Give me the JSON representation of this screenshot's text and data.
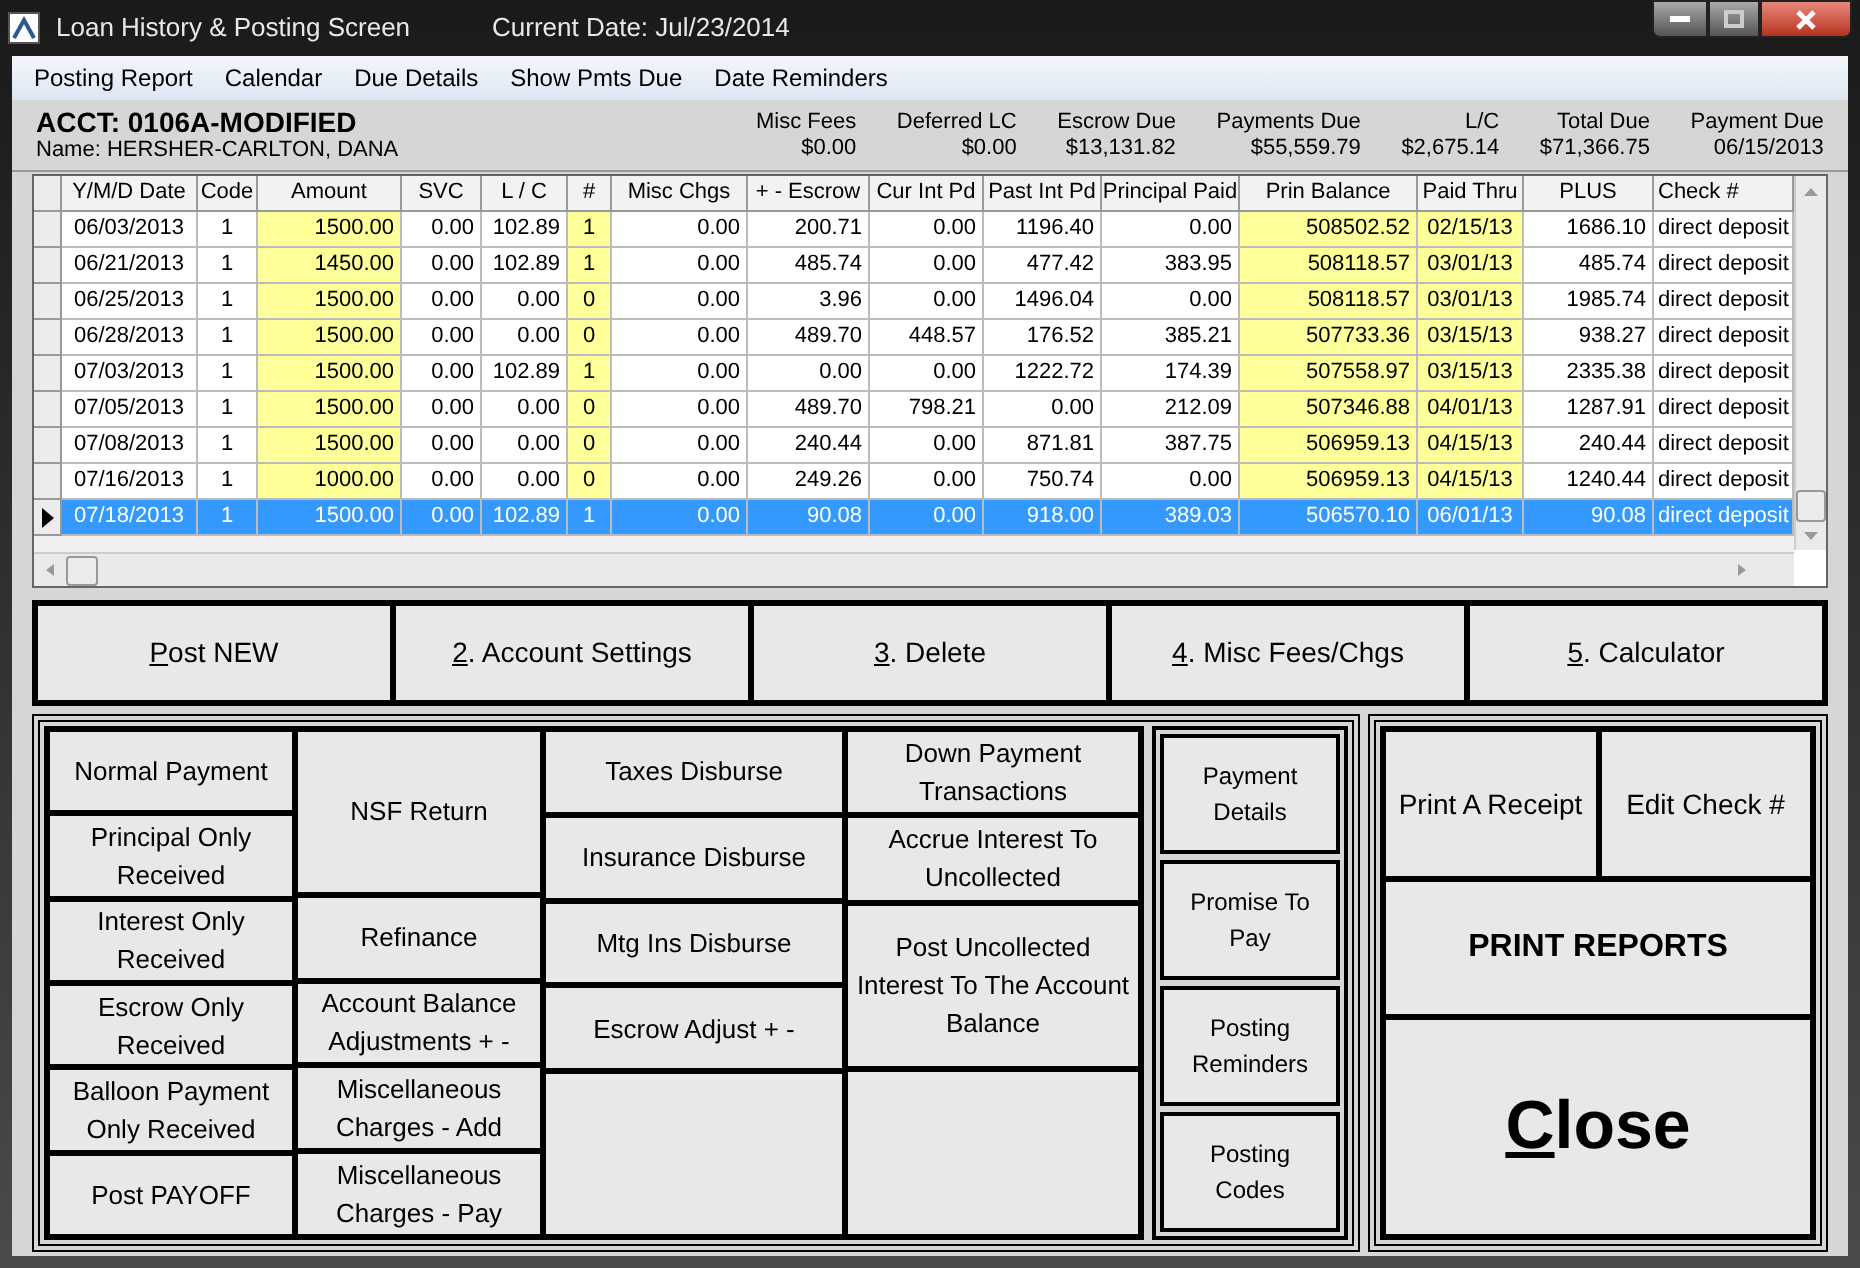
{
  "window": {
    "title": "Loan History & Posting Screen",
    "current_date": "Current Date:  Jul/23/2014"
  },
  "menu": [
    "Posting Report",
    "Calendar",
    "Due Details",
    "Show Pmts Due",
    "Date Reminders"
  ],
  "account": {
    "acct": "ACCT: 0106A-MODIFIED",
    "name": "Name: HERSHER-CARLTON, DANA"
  },
  "summary": [
    {
      "label": "Misc Fees",
      "value": "$0.00"
    },
    {
      "label": "Deferred LC",
      "value": "$0.00"
    },
    {
      "label": "Escrow Due",
      "value": "$13,131.82"
    },
    {
      "label": "Payments Due",
      "value": "$55,559.79"
    },
    {
      "label": "L/C",
      "value": "$2,675.14"
    },
    {
      "label": "Total Due",
      "value": "$71,366.75"
    },
    {
      "label": "Payment Due",
      "value": "06/15/2013"
    }
  ],
  "table": {
    "columns": [
      {
        "label": "Y/M/D Date",
        "highlight": false
      },
      {
        "label": "Code",
        "highlight": false
      },
      {
        "label": "Amount",
        "highlight": true
      },
      {
        "label": "SVC",
        "highlight": false
      },
      {
        "label": "L / C",
        "highlight": false
      },
      {
        "label": "#",
        "highlight": true
      },
      {
        "label": "Misc Chgs",
        "highlight": false
      },
      {
        "label": "+ - Escrow",
        "highlight": false
      },
      {
        "label": "Cur Int Pd",
        "highlight": false
      },
      {
        "label": "Past Int Pd",
        "highlight": false
      },
      {
        "label": "Principal Paid",
        "highlight": false
      },
      {
        "label": "Prin Balance",
        "highlight": true
      },
      {
        "label": "Paid Thru",
        "highlight": true
      },
      {
        "label": "PLUS",
        "highlight": false
      },
      {
        "label": "Check #",
        "highlight": false
      }
    ],
    "rows": [
      {
        "selected": false,
        "cells": [
          "06/03/2013",
          "1",
          "1500.00",
          "0.00",
          "102.89",
          "1",
          "0.00",
          "200.71",
          "0.00",
          "1196.40",
          "0.00",
          "508502.52",
          "02/15/13",
          "1686.10",
          "direct deposit"
        ]
      },
      {
        "selected": false,
        "cells": [
          "06/21/2013",
          "1",
          "1450.00",
          "0.00",
          "102.89",
          "1",
          "0.00",
          "485.74",
          "0.00",
          "477.42",
          "383.95",
          "508118.57",
          "03/01/13",
          "485.74",
          "direct deposit"
        ]
      },
      {
        "selected": false,
        "cells": [
          "06/25/2013",
          "1",
          "1500.00",
          "0.00",
          "0.00",
          "0",
          "0.00",
          "3.96",
          "0.00",
          "1496.04",
          "0.00",
          "508118.57",
          "03/01/13",
          "1985.74",
          "direct deposit"
        ]
      },
      {
        "selected": false,
        "cells": [
          "06/28/2013",
          "1",
          "1500.00",
          "0.00",
          "0.00",
          "0",
          "0.00",
          "489.70",
          "448.57",
          "176.52",
          "385.21",
          "507733.36",
          "03/15/13",
          "938.27",
          "direct deposit"
        ]
      },
      {
        "selected": false,
        "cells": [
          "07/03/2013",
          "1",
          "1500.00",
          "0.00",
          "102.89",
          "1",
          "0.00",
          "0.00",
          "0.00",
          "1222.72",
          "174.39",
          "507558.97",
          "03/15/13",
          "2335.38",
          "direct deposit"
        ]
      },
      {
        "selected": false,
        "cells": [
          "07/05/2013",
          "1",
          "1500.00",
          "0.00",
          "0.00",
          "0",
          "0.00",
          "489.70",
          "798.21",
          "0.00",
          "212.09",
          "507346.88",
          "04/01/13",
          "1287.91",
          "direct deposit"
        ]
      },
      {
        "selected": false,
        "cells": [
          "07/08/2013",
          "1",
          "1500.00",
          "0.00",
          "0.00",
          "0",
          "0.00",
          "240.44",
          "0.00",
          "871.81",
          "387.75",
          "506959.13",
          "04/15/13",
          "240.44",
          "direct deposit"
        ]
      },
      {
        "selected": false,
        "cells": [
          "07/16/2013",
          "1",
          "1000.00",
          "0.00",
          "0.00",
          "0",
          "0.00",
          "249.26",
          "0.00",
          "750.74",
          "0.00",
          "506959.13",
          "04/15/13",
          "1240.44",
          "direct deposit"
        ]
      },
      {
        "selected": true,
        "cells": [
          "07/18/2013",
          "1",
          "1500.00",
          "0.00",
          "102.89",
          "1",
          "0.00",
          "90.08",
          "0.00",
          "918.00",
          "389.03",
          "506570.10",
          "06/01/13",
          "90.08",
          "direct deposit"
        ]
      }
    ]
  },
  "actions": [
    {
      "accel": "P",
      "rest": "ost NEW"
    },
    {
      "accel": "2",
      "rest": ". Account Settings"
    },
    {
      "accel": "3",
      "rest": ". Delete"
    },
    {
      "accel": "4",
      "rest": ". Misc Fees/Chgs"
    },
    {
      "accel": "5",
      "rest": ". Calculator"
    }
  ],
  "posting_columns": [
    [
      {
        "kind": "single",
        "label": "Normal Payment"
      },
      {
        "kind": "single",
        "label": "Principal Only Received"
      },
      {
        "kind": "single",
        "label": "Interest Only Received"
      },
      {
        "kind": "single",
        "label": "Escrow Only Received"
      },
      {
        "kind": "single",
        "label": "Balloon Payment Only Received"
      },
      {
        "kind": "single",
        "label": "Post PAYOFF"
      }
    ],
    [
      {
        "kind": "double",
        "label": "NSF Return"
      },
      {
        "kind": "single",
        "label": "Refinance"
      },
      {
        "kind": "single",
        "label": "Account Balance Adjustments  + -"
      },
      {
        "kind": "single",
        "label": "Miscellaneous Charges - Add"
      },
      {
        "kind": "single",
        "label": "Miscellaneous Charges - Pay"
      }
    ],
    [
      {
        "kind": "single",
        "label": "Taxes Disburse"
      },
      {
        "kind": "single",
        "label": "Insurance Disburse"
      },
      {
        "kind": "single",
        "label": "Mtg Ins Disburse"
      },
      {
        "kind": "single",
        "label": "Escrow Adjust + -"
      },
      {
        "kind": "blank"
      }
    ],
    [
      {
        "kind": "single",
        "label": "Down Payment Transactions"
      },
      {
        "kind": "single",
        "label": "Accrue Interest  To Uncollected"
      },
      {
        "kind": "double",
        "label": "Post Uncollected Interest To The Account Balance"
      },
      {
        "kind": "blank"
      }
    ]
  ],
  "side_buttons": [
    "Payment Details",
    "Promise To Pay",
    "Posting Reminders",
    "Posting Codes"
  ],
  "receipt_buttons": [
    "Print A Receipt",
    "Edit Check #"
  ],
  "print_reports": "PRINT REPORTS",
  "close": {
    "accel": "C",
    "rest": "lose"
  }
}
